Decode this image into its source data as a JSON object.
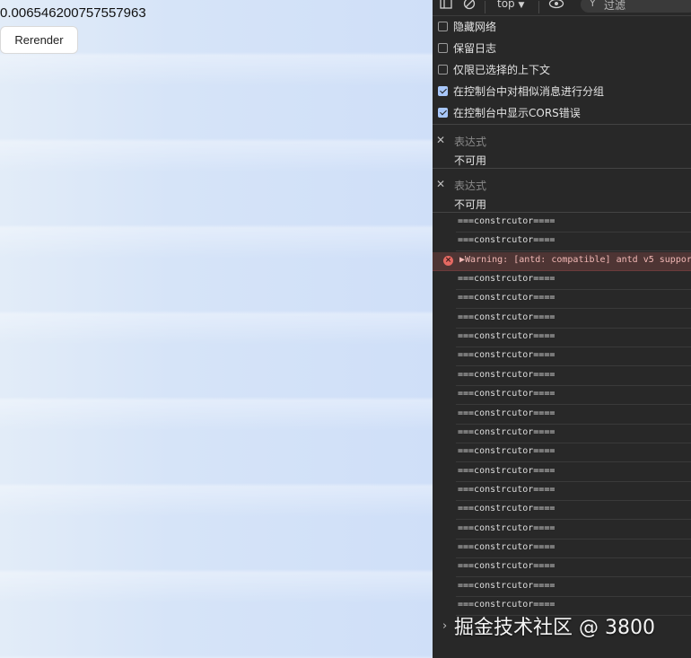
{
  "app": {
    "random_value": "0.006546200757557963",
    "rerender_label": "Rerender"
  },
  "devtools": {
    "toolbar": {
      "context": "top",
      "filter_placeholder": "过滤"
    },
    "settings": [
      {
        "label": "隐藏网络",
        "checked": false
      },
      {
        "label": "保留日志",
        "checked": false
      },
      {
        "label": "仅限已选择的上下文",
        "checked": false
      },
      {
        "label": "在控制台中对相似消息进行分组",
        "checked": true
      },
      {
        "label": "在控制台中显示CORS错误",
        "checked": true
      }
    ],
    "expressions": [
      {
        "placeholder": "表达式",
        "value": "不可用"
      },
      {
        "placeholder": "表达式",
        "value": "不可用"
      }
    ],
    "logs": [
      {
        "type": "log",
        "text": "===constrcutor===="
      },
      {
        "type": "log",
        "text": "===constrcutor===="
      },
      {
        "type": "error",
        "text": "▶Warning: [antd: compatible] antd v5 support"
      },
      {
        "type": "log",
        "text": "===constrcutor===="
      },
      {
        "type": "log",
        "text": "===constrcutor===="
      },
      {
        "type": "log",
        "text": "===constrcutor===="
      },
      {
        "type": "log",
        "text": "===constrcutor===="
      },
      {
        "type": "log",
        "text": "===constrcutor===="
      },
      {
        "type": "log",
        "text": "===constrcutor===="
      },
      {
        "type": "log",
        "text": "===constrcutor===="
      },
      {
        "type": "log",
        "text": "===constrcutor===="
      },
      {
        "type": "log",
        "text": "===constrcutor===="
      },
      {
        "type": "log",
        "text": "===constrcutor===="
      },
      {
        "type": "log",
        "text": "===constrcutor===="
      },
      {
        "type": "log",
        "text": "===constrcutor===="
      },
      {
        "type": "log",
        "text": "===constrcutor===="
      },
      {
        "type": "log",
        "text": "===constrcutor===="
      },
      {
        "type": "log",
        "text": "===constrcutor===="
      },
      {
        "type": "log",
        "text": "===constrcutor===="
      },
      {
        "type": "log",
        "text": "===constrcutor===="
      },
      {
        "type": "log",
        "text": "===constrcutor===="
      }
    ],
    "watermark": "掘金技术社区 @ 3800"
  }
}
